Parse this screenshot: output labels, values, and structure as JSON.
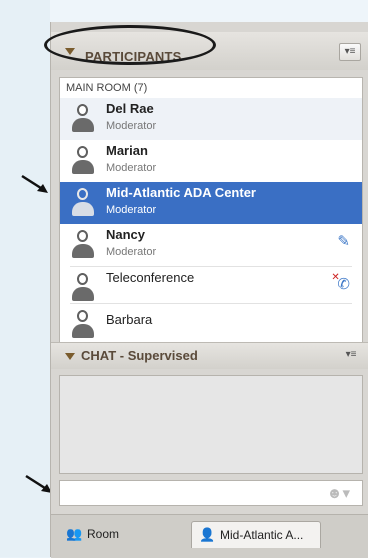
{
  "participants": {
    "title": "PARTICIPANTS",
    "room_label": "MAIN ROOM (7)",
    "items": [
      {
        "name": "Del Rae",
        "role": "Moderator"
      },
      {
        "name": "Marian",
        "role": "Moderator"
      },
      {
        "name": "Mid-Atlantic ADA Center",
        "role": "Moderator",
        "selected": true
      },
      {
        "name": "Nancy",
        "role": "Moderator",
        "status_icon": "microphone-icon"
      },
      {
        "name": "Teleconference",
        "role": "",
        "status_icon": "phone-muted-icon"
      },
      {
        "name": "Barbara",
        "role": ""
      }
    ]
  },
  "chat": {
    "title": "CHAT - Supervised",
    "input_value": "",
    "emoji_icon": "emoji-icon"
  },
  "tabs": [
    {
      "label": "Room",
      "icon": "users-icon"
    },
    {
      "label": "Mid-Atlantic A...",
      "icon": "user-icon",
      "active": true
    }
  ],
  "colors": {
    "selection": "#3a6fc4",
    "panel": "#d8d6d2",
    "header_text": "#5a4a3a"
  }
}
